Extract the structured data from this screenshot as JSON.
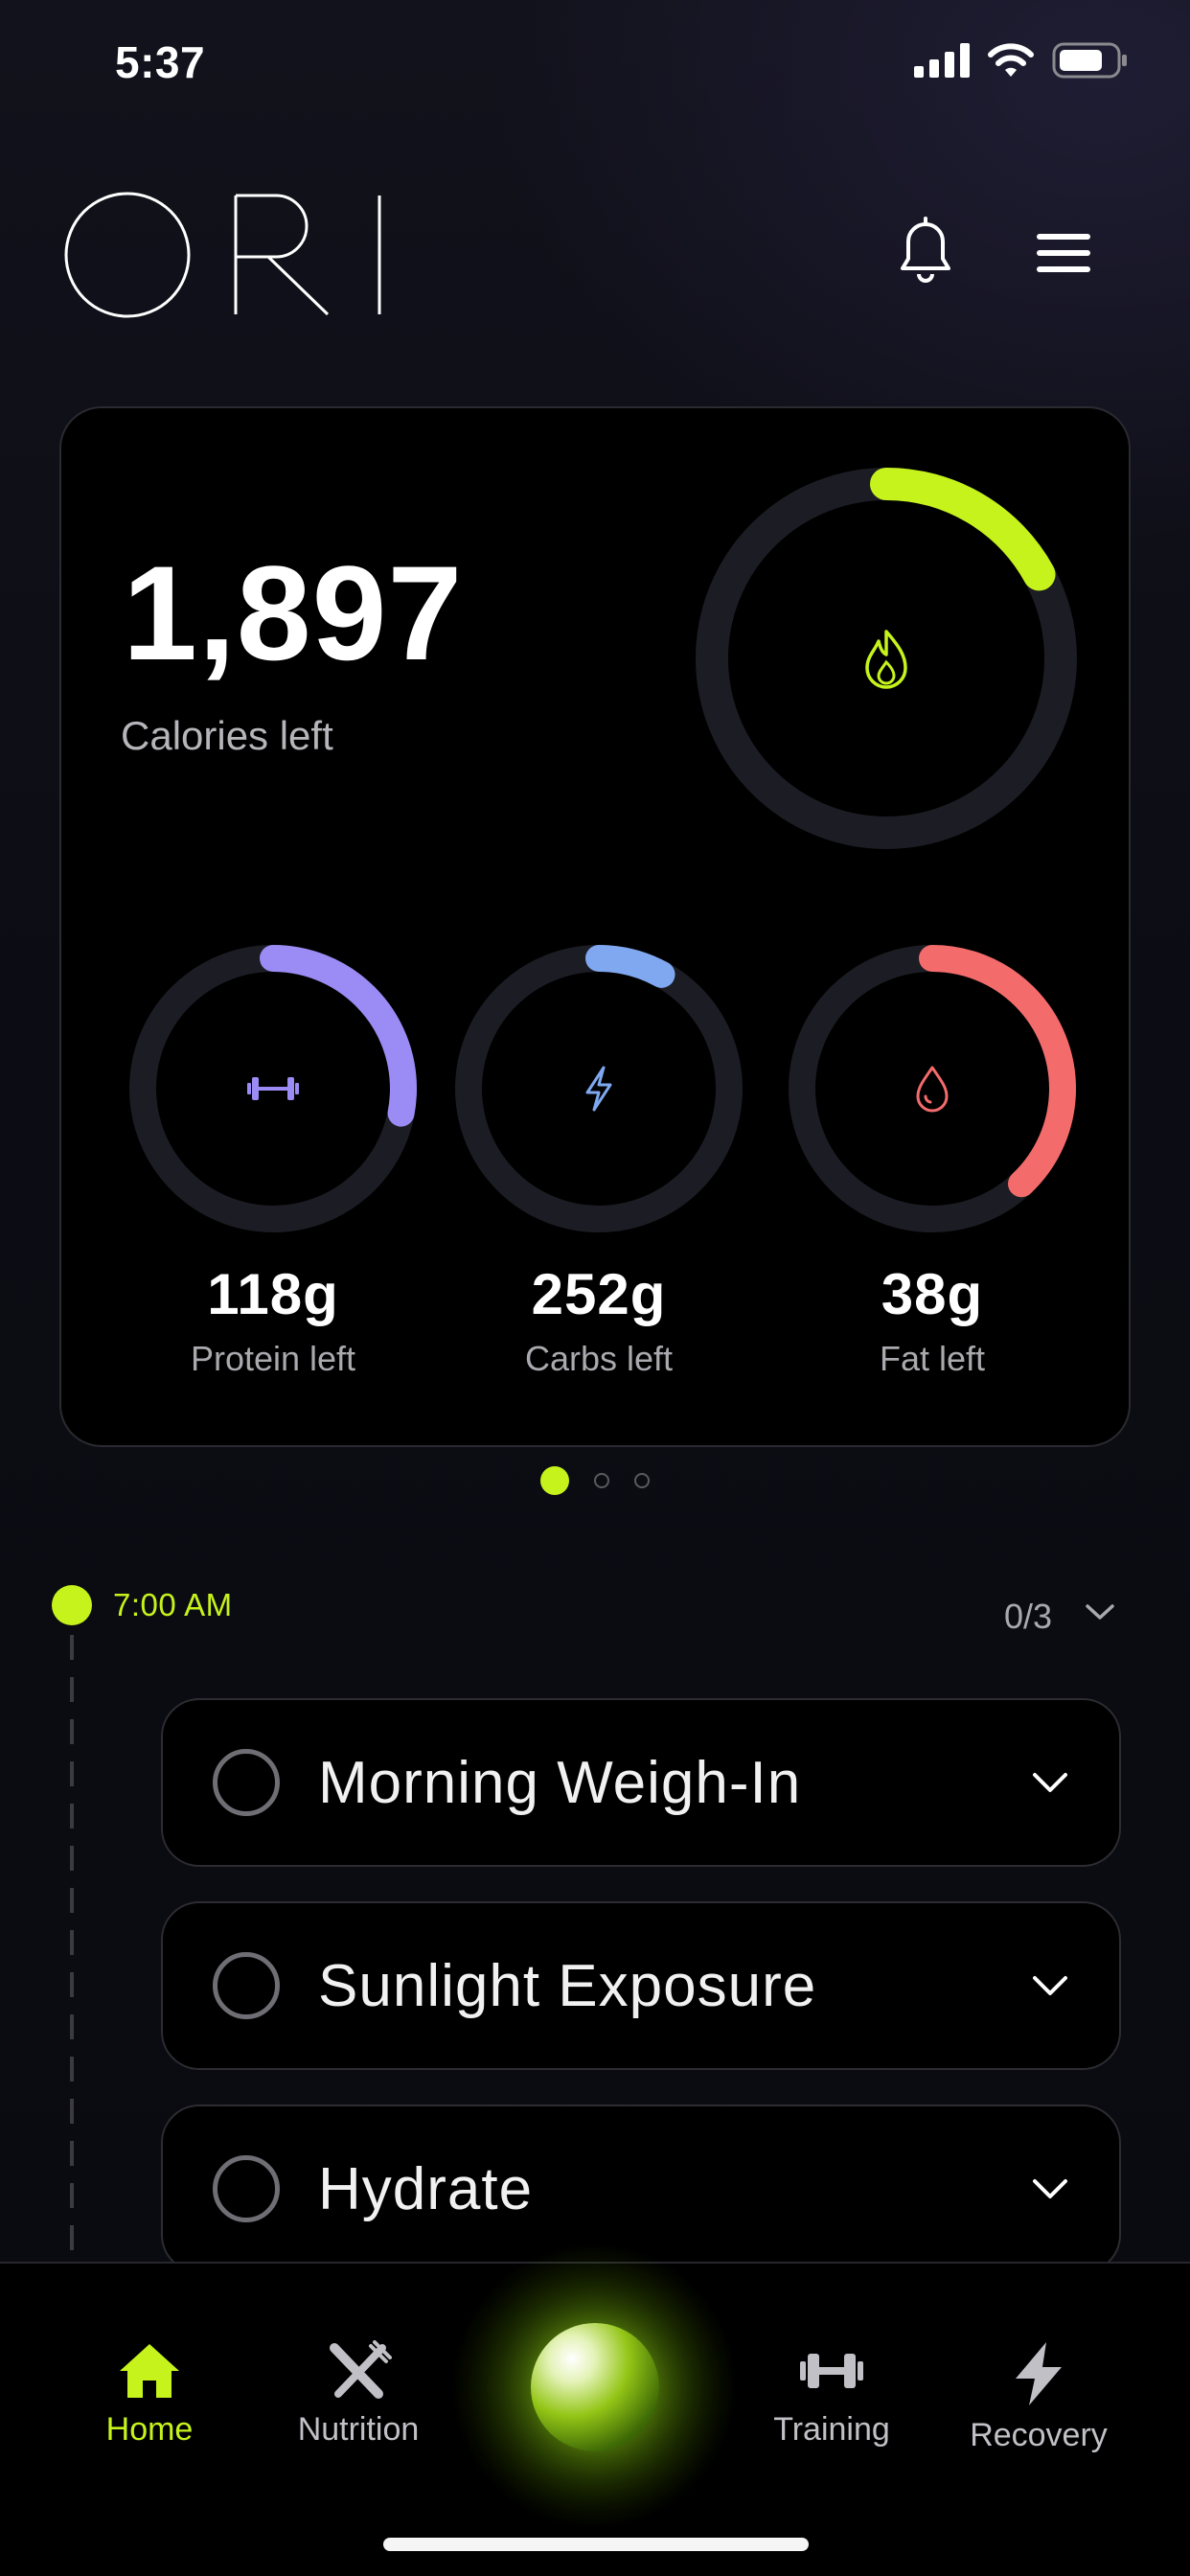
{
  "status_bar": {
    "time": "5:37"
  },
  "header": {
    "logo_text": "ORI"
  },
  "summary": {
    "calories_value": "1,897",
    "calories_label": "Calories left",
    "calories_progress": 0.17,
    "macros": [
      {
        "value": "118g",
        "label": "Protein left",
        "color": "#9b8bf4",
        "progress": 0.28,
        "icon": "dumbbell-icon"
      },
      {
        "value": "252g",
        "label": "Carbs left",
        "color": "#7fa8f0",
        "progress": 0.08,
        "icon": "bolt-icon"
      },
      {
        "value": "38g",
        "label": "Fat left",
        "color": "#f46b6b",
        "progress": 0.38,
        "icon": "drop-icon"
      }
    ],
    "accent_color": "#c6f31c"
  },
  "pager": {
    "count": 3,
    "active": 0
  },
  "timeline": {
    "time": "7:00 AM",
    "count": "0/3",
    "tasks": [
      {
        "title": "Morning Weigh-In"
      },
      {
        "title": "Sunlight Exposure"
      },
      {
        "title": "Hydrate"
      }
    ]
  },
  "nav": {
    "items": [
      {
        "label": "Home",
        "icon": "home-icon",
        "active": true
      },
      {
        "label": "Nutrition",
        "icon": "utensils-icon"
      },
      {
        "label": "Training",
        "icon": "dumbbell-icon"
      },
      {
        "label": "Recovery",
        "icon": "bolt-icon"
      }
    ]
  }
}
